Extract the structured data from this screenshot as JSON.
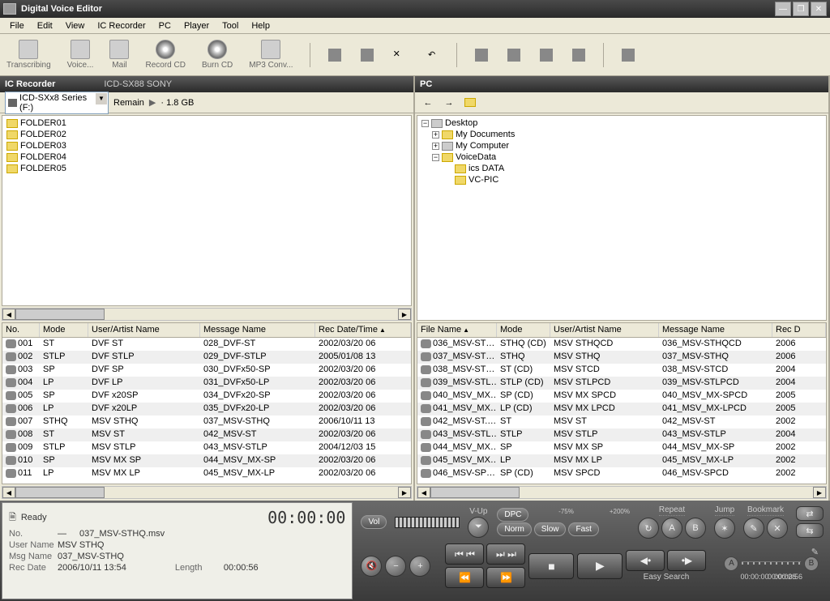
{
  "window": {
    "title": "Digital Voice Editor"
  },
  "menus": [
    "File",
    "Edit",
    "View",
    "IC Recorder",
    "PC",
    "Player",
    "Tool",
    "Help"
  ],
  "toolbar": [
    {
      "id": "transcribing",
      "label": "Transcribing"
    },
    {
      "id": "voice",
      "label": "Voice..."
    },
    {
      "id": "mail",
      "label": "Mail"
    },
    {
      "id": "record-cd",
      "label": "Record CD",
      "cd": true
    },
    {
      "id": "burn-cd",
      "label": "Burn CD",
      "cd": true
    },
    {
      "id": "mp3-conv",
      "label": "MP3 Conv..."
    }
  ],
  "left_panel": {
    "title": "IC Recorder",
    "subtitle": "ICD-SX88 SONY",
    "device_selector": "ICD-SXx8 Series (F:)",
    "remain_label": "Remain",
    "remain_value": "· 1.8 GB",
    "folders": [
      "FOLDER01",
      "FOLDER02",
      "FOLDER03",
      "FOLDER04",
      "FOLDER05"
    ],
    "columns": [
      "No.",
      "Mode",
      "User/Artist Name",
      "Message Name",
      "Rec Date/Time"
    ],
    "rows": [
      {
        "no": "001",
        "mode": "ST",
        "user": "DVF ST",
        "msg": "028_DVF-ST",
        "date": "2002/03/20 06"
      },
      {
        "no": "002",
        "mode": "STLP",
        "user": "DVF STLP",
        "msg": "029_DVF-STLP",
        "date": "2005/01/08 13"
      },
      {
        "no": "003",
        "mode": "SP",
        "user": "DVF SP",
        "msg": "030_DVFx50-SP",
        "date": "2002/03/20 06"
      },
      {
        "no": "004",
        "mode": "LP",
        "user": "DVF LP",
        "msg": "031_DVFx50-LP",
        "date": "2002/03/20 06"
      },
      {
        "no": "005",
        "mode": "SP",
        "user": "DVF x20SP",
        "msg": "034_DVFx20-SP",
        "date": "2002/03/20 06"
      },
      {
        "no": "006",
        "mode": "LP",
        "user": "DVF x20LP",
        "msg": "035_DVFx20-LP",
        "date": "2002/03/20 06"
      },
      {
        "no": "007",
        "mode": "STHQ",
        "user": "MSV STHQ",
        "msg": "037_MSV-STHQ",
        "date": "2006/10/11 13"
      },
      {
        "no": "008",
        "mode": "ST",
        "user": "MSV ST",
        "msg": "042_MSV-ST",
        "date": "2002/03/20 06"
      },
      {
        "no": "009",
        "mode": "STLP",
        "user": "MSV STLP",
        "msg": "043_MSV-STLP",
        "date": "2004/12/03 15"
      },
      {
        "no": "010",
        "mode": "SP",
        "user": "MSV MX SP",
        "msg": "044_MSV_MX-SP",
        "date": "2002/03/20 06"
      },
      {
        "no": "011",
        "mode": "LP",
        "user": "MSV MX LP",
        "msg": "045_MSV_MX-LP",
        "date": "2002/03/20 06"
      }
    ]
  },
  "right_panel": {
    "title": "PC",
    "tree": {
      "root": "Desktop",
      "children": [
        "My Documents",
        "My Computer"
      ],
      "voice_data": "VoiceData",
      "voice_children": [
        "ics DATA",
        "VC-PIC"
      ]
    },
    "columns": [
      "File Name",
      "Mode",
      "User/Artist Name",
      "Message Name",
      "Rec D"
    ],
    "rows": [
      {
        "file": "036_MSV-ST…",
        "mode": "STHQ (CD)",
        "user": "MSV STHQCD",
        "msg": "036_MSV-STHQCD",
        "date": "2006"
      },
      {
        "file": "037_MSV-ST…",
        "mode": "STHQ",
        "user": "MSV STHQ",
        "msg": "037_MSV-STHQ",
        "date": "2006"
      },
      {
        "file": "038_MSV-ST…",
        "mode": "ST (CD)",
        "user": "MSV STCD",
        "msg": "038_MSV-STCD",
        "date": "2004"
      },
      {
        "file": "039_MSV-STL…",
        "mode": "STLP (CD)",
        "user": "MSV STLPCD",
        "msg": "039_MSV-STLPCD",
        "date": "2004"
      },
      {
        "file": "040_MSV_MX…",
        "mode": "SP (CD)",
        "user": "MSV MX SPCD",
        "msg": "040_MSV_MX-SPCD",
        "date": "2005"
      },
      {
        "file": "041_MSV_MX…",
        "mode": "LP (CD)",
        "user": "MSV MX LPCD",
        "msg": "041_MSV_MX-LPCD",
        "date": "2005"
      },
      {
        "file": "042_MSV-ST.…",
        "mode": "ST",
        "user": "MSV ST",
        "msg": "042_MSV-ST",
        "date": "2002"
      },
      {
        "file": "043_MSV-STL…",
        "mode": "STLP",
        "user": "MSV STLP",
        "msg": "043_MSV-STLP",
        "date": "2004"
      },
      {
        "file": "044_MSV_MX…",
        "mode": "SP",
        "user": "MSV MX SP",
        "msg": "044_MSV_MX-SP",
        "date": "2002"
      },
      {
        "file": "045_MSV_MX…",
        "mode": "LP",
        "user": "MSV MX LP",
        "msg": "045_MSV_MX-LP",
        "date": "2002"
      },
      {
        "file": "046_MSV-SP…",
        "mode": "SP (CD)",
        "user": "MSV SPCD",
        "msg": "046_MSV-SPCD",
        "date": "2002"
      }
    ]
  },
  "player": {
    "ready": "Ready",
    "elapsed": "00:00:00",
    "no_label": "No.",
    "no_value": "—",
    "file": "037_MSV-STHQ.msv",
    "user_label": "User Name",
    "user_value": "MSV STHQ",
    "msg_label": "Msg Name",
    "msg_value": "037_MSV-STHQ",
    "rec_label": "Rec Date",
    "rec_value": "2006/10/11 13:54",
    "length_label": "Length",
    "length_value": "00:00:56",
    "vol": "Vol",
    "vup": "V-Up",
    "dpc": "DPC",
    "dpc_low": "-75%",
    "dpc_high": "+200%",
    "norm": "Norm",
    "slow": "Slow",
    "fast": "Fast",
    "repeat": "Repeat",
    "jump": "Jump",
    "bookmark": "Bookmark",
    "easy_search": "Easy Search",
    "tl_start": "00:00:00",
    "tl_mid": "00:00:28",
    "tl_end": "00:00:56"
  }
}
